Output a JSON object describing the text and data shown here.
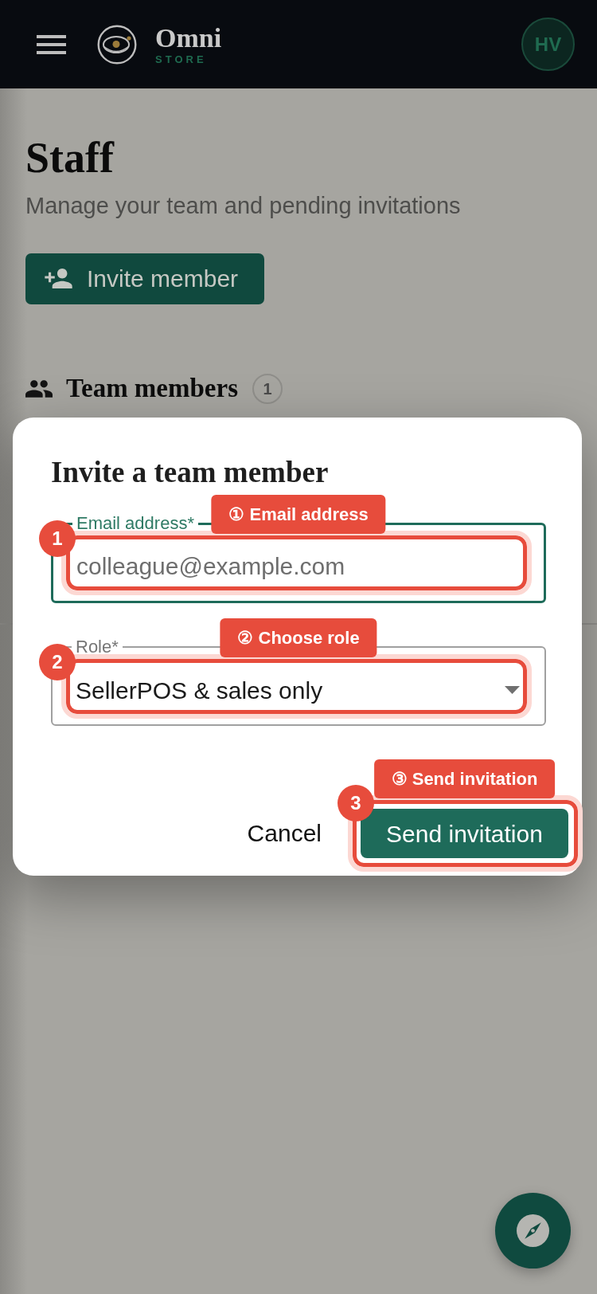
{
  "header": {
    "brand": {
      "name": "Omni",
      "tagline": "STORE"
    },
    "avatar": {
      "initials": "HV"
    }
  },
  "page": {
    "title": "Staff",
    "subtitle": "Manage your team and pending invitations",
    "primary_action": {
      "label": "Invite member"
    },
    "section": {
      "title": "Team members",
      "count": "1"
    }
  },
  "dialog": {
    "title": "Invite a team member",
    "fields": [
      {
        "kind": "text",
        "label": "Email address*",
        "placeholder": "colleague@example.com",
        "focused": true,
        "annotation": {
          "number": "1",
          "callout": "① Email address"
        }
      },
      {
        "kind": "select",
        "label": "Role*",
        "value": "SellerPOS & sales only",
        "focused": false,
        "annotation": {
          "number": "2",
          "callout": "② Choose role"
        }
      }
    ],
    "actions": [
      {
        "kind": "secondary",
        "label": "Cancel"
      },
      {
        "kind": "primary",
        "label": "Send invitation",
        "annotation": {
          "number": "3",
          "callout": "③ Send invitation"
        }
      }
    ]
  }
}
